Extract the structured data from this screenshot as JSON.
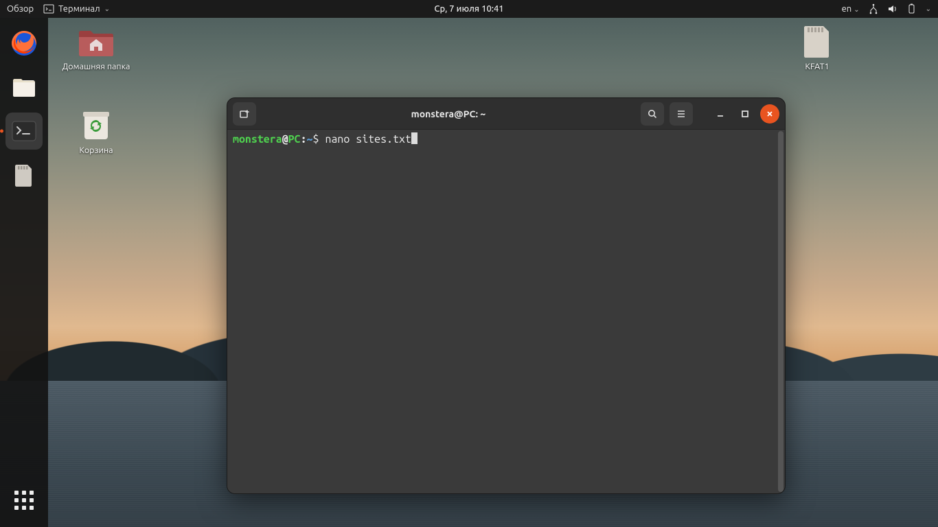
{
  "topbar": {
    "activities": "Обзор",
    "app_indicator": "Терминал",
    "clock": "Ср, 7 июля  10:41",
    "input_lang": "en"
  },
  "desktop_icons": {
    "home": "Домашняя папка",
    "trash": "Корзина",
    "sdcard": "KFAT1"
  },
  "dock": {
    "items": [
      "firefox",
      "files",
      "terminal",
      "sdcard"
    ],
    "active": "terminal"
  },
  "terminal": {
    "title": "monstera@PC: ~",
    "prompt": {
      "user": "monstera",
      "host": "PC",
      "path": "~",
      "symbol": "$"
    },
    "command": "nano sites.txt"
  }
}
